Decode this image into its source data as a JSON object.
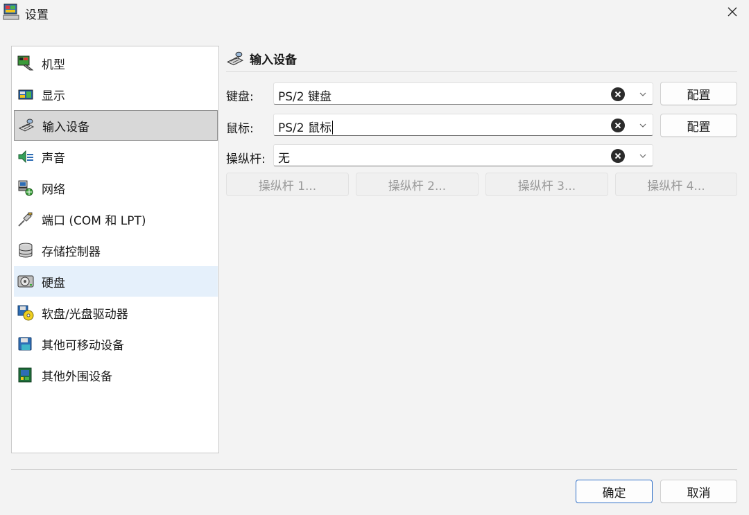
{
  "window": {
    "title": "设置",
    "app_icon": "app-computer-icon",
    "close_icon": "close-icon"
  },
  "sidebar": {
    "items": [
      {
        "label": "机型",
        "icon": "machine-icon",
        "state": "normal"
      },
      {
        "label": "显示",
        "icon": "display-icon",
        "state": "normal"
      },
      {
        "label": "输入设备",
        "icon": "input-device-icon",
        "state": "selected"
      },
      {
        "label": "声音",
        "icon": "speaker-icon",
        "state": "normal"
      },
      {
        "label": "网络",
        "icon": "network-icon",
        "state": "normal"
      },
      {
        "label": "端口 (COM 和 LPT)",
        "icon": "port-cable-icon",
        "state": "normal"
      },
      {
        "label": "存储控制器",
        "icon": "storage-controller-icon",
        "state": "normal"
      },
      {
        "label": "硬盘",
        "icon": "hard-disk-icon",
        "state": "hover"
      },
      {
        "label": "软盘/光盘驱动器",
        "icon": "floppy-cd-icon",
        "state": "normal"
      },
      {
        "label": "其他可移动设备",
        "icon": "removable-device-icon",
        "state": "normal"
      },
      {
        "label": "其他外围设备",
        "icon": "peripheral-chip-icon",
        "state": "normal"
      }
    ]
  },
  "section": {
    "title": "输入设备",
    "icon": "input-device-icon"
  },
  "keyboard": {
    "label": "键盘:",
    "value": "PS/2 键盘",
    "configure": "配置"
  },
  "mouse": {
    "label": "鼠标:",
    "value": "PS/2 鼠标",
    "configure": "配置"
  },
  "joystick": {
    "label": "操纵杆:",
    "value": "无",
    "buttons": [
      "操纵杆 1...",
      "操纵杆 2...",
      "操纵杆 3...",
      "操纵杆 4..."
    ]
  },
  "footer": {
    "ok": "确定",
    "cancel": "取消"
  },
  "colors": {
    "selected_bg": "#d8d8d8",
    "hover_bg": "#e5f0fb",
    "primary_border": "#2f6fc8"
  }
}
